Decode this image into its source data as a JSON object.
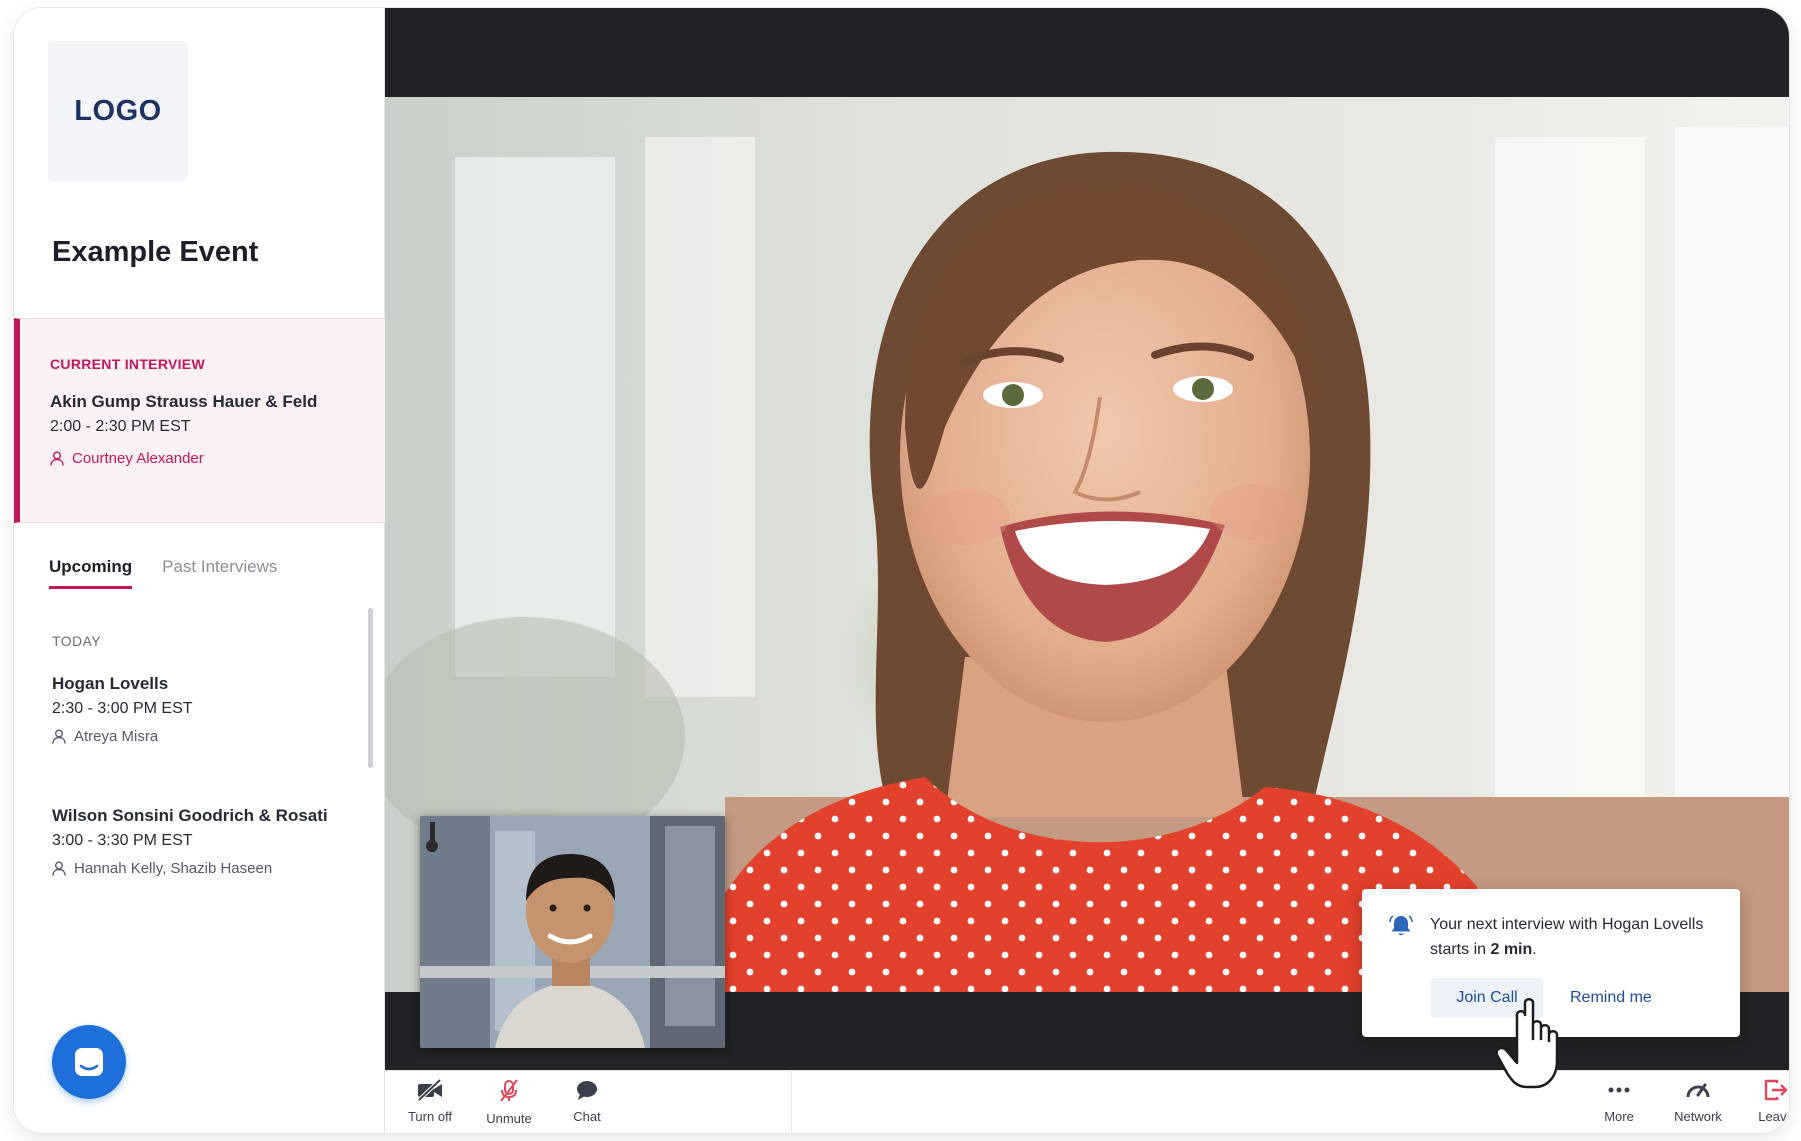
{
  "sidebar": {
    "logo_text": "LOGO",
    "event_title": "Example Event",
    "current_interview": {
      "label": "CURRENT INTERVIEW",
      "firm": "Akin Gump Strauss Hauer & Feld",
      "time": "2:00 - 2:30 PM EST",
      "interviewer": "Courtney Alexander"
    },
    "tabs": [
      {
        "label": "Upcoming",
        "active": true
      },
      {
        "label": "Past Interviews",
        "active": false
      }
    ],
    "day_label": "TODAY",
    "upcoming": [
      {
        "firm": "Hogan Lovells",
        "time": "2:30 - 3:00 PM EST",
        "interviewers": "Atreya Misra"
      },
      {
        "firm": "Wilson Sonsini Goodrich & Rosati",
        "time": "3:00 - 3:30 PM EST",
        "interviewers": "Hannah Kelly, Shazib Haseen"
      }
    ]
  },
  "notification": {
    "message_prefix": "Your next interview with Hogan Lovells starts in ",
    "message_bold": "2 min",
    "message_suffix": ".",
    "join_label": "Join Call",
    "remind_label": "Remind me"
  },
  "controls": {
    "turn_off": "Turn off",
    "unmute": "Unmute",
    "chat": "Chat",
    "more": "More",
    "network": "Network",
    "leave": "Leave"
  },
  "colors": {
    "accent": "#c2185b",
    "link": "#1d4e9b",
    "fab": "#1e6fd9",
    "video_bg": "#222326",
    "danger": "#e0475a"
  },
  "icons": {
    "camera_off": "camera-off-icon",
    "mic_off": "mic-off-icon",
    "chat": "chat-bubble-icon",
    "more": "more-dots-icon",
    "network": "gauge-icon",
    "leave": "leave-icon",
    "bell": "bell-icon",
    "person": "person-icon",
    "support": "chat-support-icon"
  }
}
